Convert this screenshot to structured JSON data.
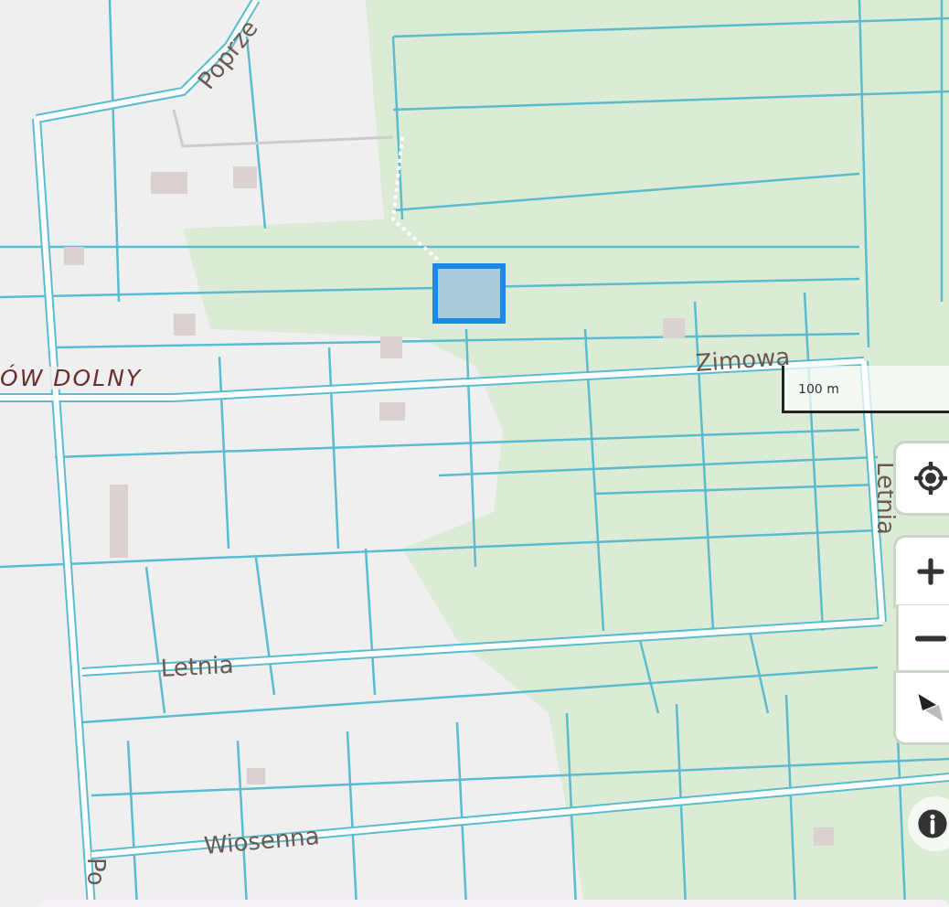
{
  "map": {
    "labels": [
      {
        "text": "Poprze",
        "kind": "street"
      },
      {
        "text": "ÓW DOLNY",
        "kind": "place"
      },
      {
        "text": "Zimowa",
        "kind": "street"
      },
      {
        "text": "Letnia",
        "kind": "street"
      },
      {
        "text": "Letnia",
        "kind": "street"
      },
      {
        "text": "Wiosenna",
        "kind": "street"
      },
      {
        "text": "Po",
        "kind": "street"
      }
    ]
  },
  "scale_bar": {
    "label": "100 m"
  },
  "controls": [
    {
      "kind": "locate"
    },
    {
      "kind": "zoom-in"
    },
    {
      "kind": "zoom-out"
    },
    {
      "kind": "compass"
    },
    {
      "kind": "info"
    }
  ]
}
